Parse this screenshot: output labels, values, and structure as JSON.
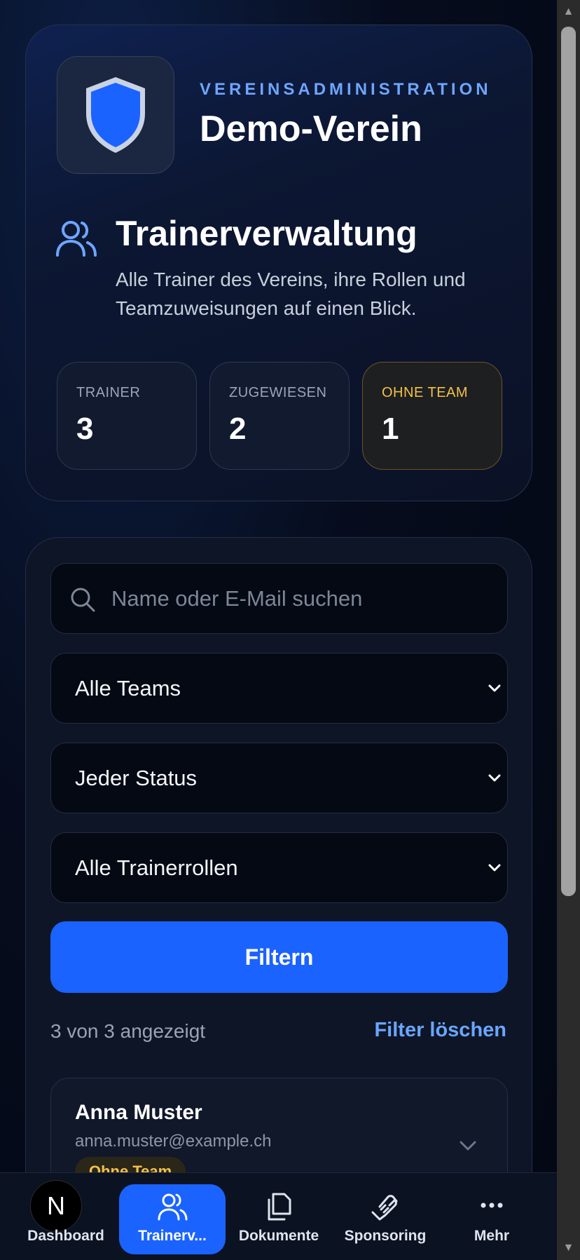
{
  "header": {
    "eyebrow": "VEREINSADMINISTRATION",
    "club_name": "Demo-Verein"
  },
  "section": {
    "title": "Trainerverwaltung",
    "description": "Alle Trainer des Vereins, ihre Rollen und Teamzuweisungen auf einen Blick."
  },
  "stats": [
    {
      "label": "TRAINER",
      "value": "3"
    },
    {
      "label": "ZUGEWIESEN",
      "value": "2"
    },
    {
      "label": "OHNE TEAM",
      "value": "1"
    }
  ],
  "filters": {
    "search_placeholder": "Name oder E-Mail suchen",
    "team_select": "Alle Teams",
    "status_select": "Jeder Status",
    "role_select": "Alle Trainerrollen",
    "filter_button": "Filtern",
    "result_count": "3 von 3 angezeigt",
    "clear_link": "Filter löschen"
  },
  "trainers": [
    {
      "name": "Anna Muster",
      "email": "anna.muster@example.ch",
      "badge": "Ohne Team"
    }
  ],
  "nav": {
    "avatar_initial": "N",
    "items": [
      {
        "label": "Dashboard",
        "icon": "avatar"
      },
      {
        "label": "Trainerv...",
        "icon": "users-icon"
      },
      {
        "label": "Dokumente",
        "icon": "documents-icon"
      },
      {
        "label": "Sponsoring",
        "icon": "handshake-icon"
      },
      {
        "label": "Mehr",
        "icon": "more-icon"
      }
    ]
  },
  "colors": {
    "accent": "#1b63ff",
    "link": "#69a6ff",
    "warning": "#f3c14b",
    "background": "#050a18"
  }
}
